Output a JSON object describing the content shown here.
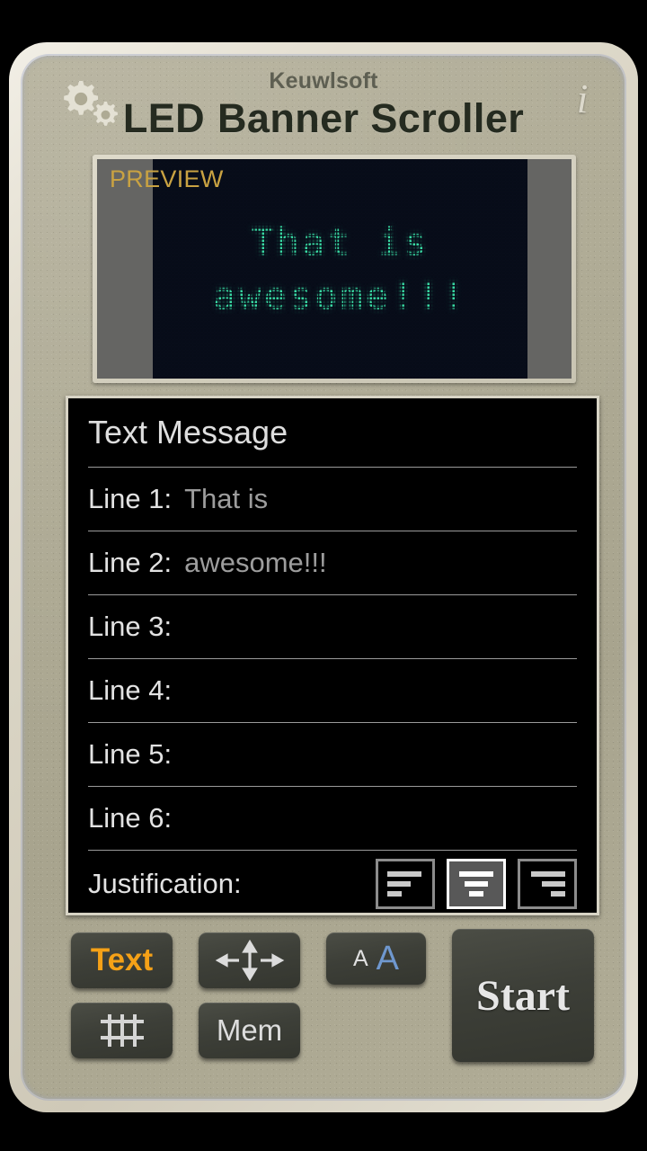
{
  "header": {
    "brand": "Keuwlsoft",
    "title_led": "LED",
    "title_rest": "Banner Scroller",
    "settings_icon": "gears-icon",
    "info_icon": "i"
  },
  "preview": {
    "label": "PREVIEW",
    "led_line1": "That is",
    "led_line2": "awesome!!!",
    "led_on_color": "#38d9a2",
    "led_off_color": "#0d1a2e",
    "side_panel_color": "#656563",
    "label_color": "#c9a242"
  },
  "message": {
    "title": "Text Message",
    "lines": [
      {
        "label": "Line 1:",
        "value": "That is"
      },
      {
        "label": "Line 2:",
        "value": "awesome!!!"
      },
      {
        "label": "Line 3:",
        "value": ""
      },
      {
        "label": "Line 4:",
        "value": ""
      },
      {
        "label": "Line 5:",
        "value": ""
      },
      {
        "label": "Line 6:",
        "value": ""
      }
    ],
    "justification": {
      "label": "Justification:",
      "options": [
        "left",
        "center",
        "right"
      ],
      "selected": "center"
    }
  },
  "toolbar": {
    "text_label": "Text",
    "grid_icon": "grid-icon",
    "direction_icon": "four-arrows-icon",
    "mem_label": "Mem",
    "font_small": "A",
    "font_large": "A",
    "start_label": "Start"
  }
}
